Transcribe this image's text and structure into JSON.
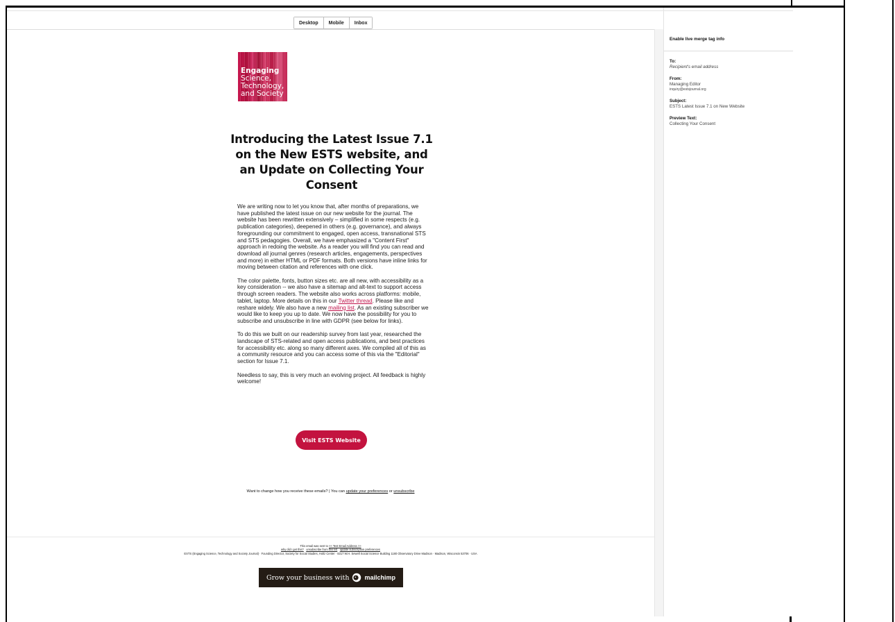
{
  "view_toggle": {
    "desktop": "Desktop",
    "mobile": "Mobile",
    "inbox": "Inbox"
  },
  "logo": {
    "line1": "Engaging",
    "line2": "Science,",
    "line3": "Technology,",
    "line4": "and Society"
  },
  "headline": "Introducing the Latest Issue 7.1 on the New ESTS website, and an Update on Collecting Your Consent",
  "body": {
    "p1": "We are writing now to let you know that, after months of preparations, we have published the latest issue on our new website for the journal. The website has been rewritten extensively – simplified in some respects (e.g. publication categories), deepened in others (e.g. governance), and always foregrounding our commitment to engaged, open access, transnational STS and STS pedagogies. Overall, we have emphasized a \"Content First\" approach in redoing the website. As a reader you will find you can read and download all journal genres (research articles, engagements, perspectives and more) in either HTML or PDF formats. Both versions have inline links for moving between citation and references with one click.",
    "p2_a": "The color palette, fonts, button sizes etc. are all new, with accessibility as a key consideration -- we also have a sitemap and alt-text to support access through screen readers. The website also works across platforms: mobile, tablet, laptop. More details on this in our ",
    "p2_link1": "Twitter thread",
    "p2_b": ". Please like and reshare widely. We also have a new ",
    "p2_link2": "mailing list",
    "p2_c": ". As an existing subscriber we would like to keep you up to date. We now have the possibility for you to subscribe and unsubscribe in line with GDPR (see below for links).",
    "p3": "To do this we built on our readership survey from last year, researched the landscape of STS-related and open access publications, and best practices for accessibility etc. along so many different axes. We compiled all of this as a community resource and you can access some of this via the \"Editorial\" section for Issue 7.1.",
    "p4": "Needless to say, this is very much an evolving project. All feedback is highly welcome!"
  },
  "cta": {
    "label": "Visit ESTS Website"
  },
  "prefs": {
    "text": "Want to change how you receive these emails? | You can ",
    "update_link": "update your preferences",
    "or": " or ",
    "unsubscribe_link": "unsubscribe"
  },
  "footer": {
    "sent_to_text": "This email was sent to ",
    "sent_to_link": "<< Test Email Address >>",
    "why_link": "why did I get this?",
    "unsub_list_link": "unsubscribe from this list",
    "update_sub_link": "update subscription preferences",
    "address": "ESTS (Engaging Science, Technology and Society Journal) · Founding Director, Society for Social Studies, Holtz Center · 8317 W.H. Sewell Social Science Building 1180 Observatory Drive Madison · Madison, Wisconsin 53706 · USA",
    "badge_grow": "Grow your business with",
    "badge_brand": "mailchimp",
    "badge_icon": "mailchimp-freddie-icon"
  },
  "sidebar": {
    "merge_toggle": "Enable live merge tag info",
    "to_label": "To:",
    "to_value": "Recipient's email address",
    "from_label": "From:",
    "from_name": "Managing Editor",
    "from_email": "inquiry@estsjournal.org",
    "subject_label": "Subject:",
    "subject_value": "ESTS Latest Issue 7.1 on New Website",
    "preview_label": "Preview Text:",
    "preview_value": "Collecting Your Consent"
  }
}
